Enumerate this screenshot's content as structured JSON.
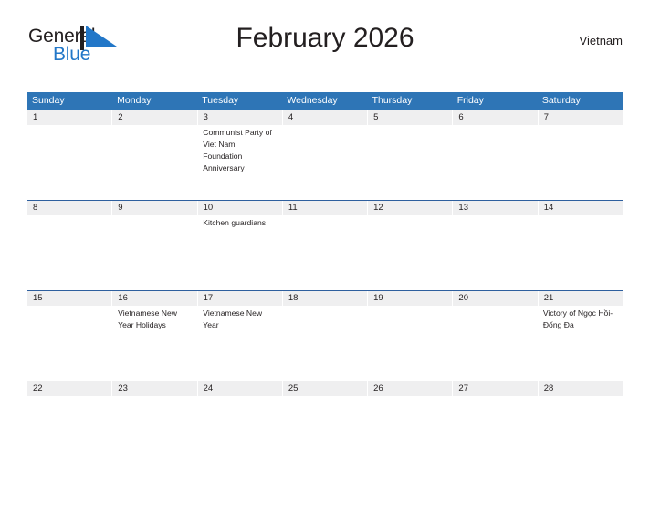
{
  "brand": {
    "name_part1": "General",
    "name_part2": "Blue",
    "mark_icon": "flag-triangle-icon",
    "color_dark": "#231f20",
    "color_blue": "#2277c8"
  },
  "header": {
    "title": "February 2026",
    "region": "Vietnam"
  },
  "calendar": {
    "header_bg": "#2e75b6",
    "row_divider": "#2e5f9e",
    "date_band_bg": "#efeff0",
    "weekdays": [
      "Sunday",
      "Monday",
      "Tuesday",
      "Wednesday",
      "Thursday",
      "Friday",
      "Saturday"
    ],
    "weeks": [
      {
        "days": [
          {
            "date": "1",
            "events": ""
          },
          {
            "date": "2",
            "events": ""
          },
          {
            "date": "3",
            "events": "Communist Party of Viet Nam Foundation Anniversary"
          },
          {
            "date": "4",
            "events": ""
          },
          {
            "date": "5",
            "events": ""
          },
          {
            "date": "6",
            "events": ""
          },
          {
            "date": "7",
            "events": ""
          }
        ]
      },
      {
        "days": [
          {
            "date": "8",
            "events": ""
          },
          {
            "date": "9",
            "events": ""
          },
          {
            "date": "10",
            "events": "Kitchen guardians"
          },
          {
            "date": "11",
            "events": ""
          },
          {
            "date": "12",
            "events": ""
          },
          {
            "date": "13",
            "events": ""
          },
          {
            "date": "14",
            "events": ""
          }
        ]
      },
      {
        "days": [
          {
            "date": "15",
            "events": ""
          },
          {
            "date": "16",
            "events": "Vietnamese New Year Holidays"
          },
          {
            "date": "17",
            "events": "Vietnamese New Year"
          },
          {
            "date": "18",
            "events": ""
          },
          {
            "date": "19",
            "events": ""
          },
          {
            "date": "20",
            "events": ""
          },
          {
            "date": "21",
            "events": "Victory of Ngọc Hồi-Đống Đa"
          }
        ]
      },
      {
        "days": [
          {
            "date": "22",
            "events": ""
          },
          {
            "date": "23",
            "events": ""
          },
          {
            "date": "24",
            "events": ""
          },
          {
            "date": "25",
            "events": ""
          },
          {
            "date": "26",
            "events": ""
          },
          {
            "date": "27",
            "events": ""
          },
          {
            "date": "28",
            "events": ""
          }
        ]
      }
    ]
  }
}
